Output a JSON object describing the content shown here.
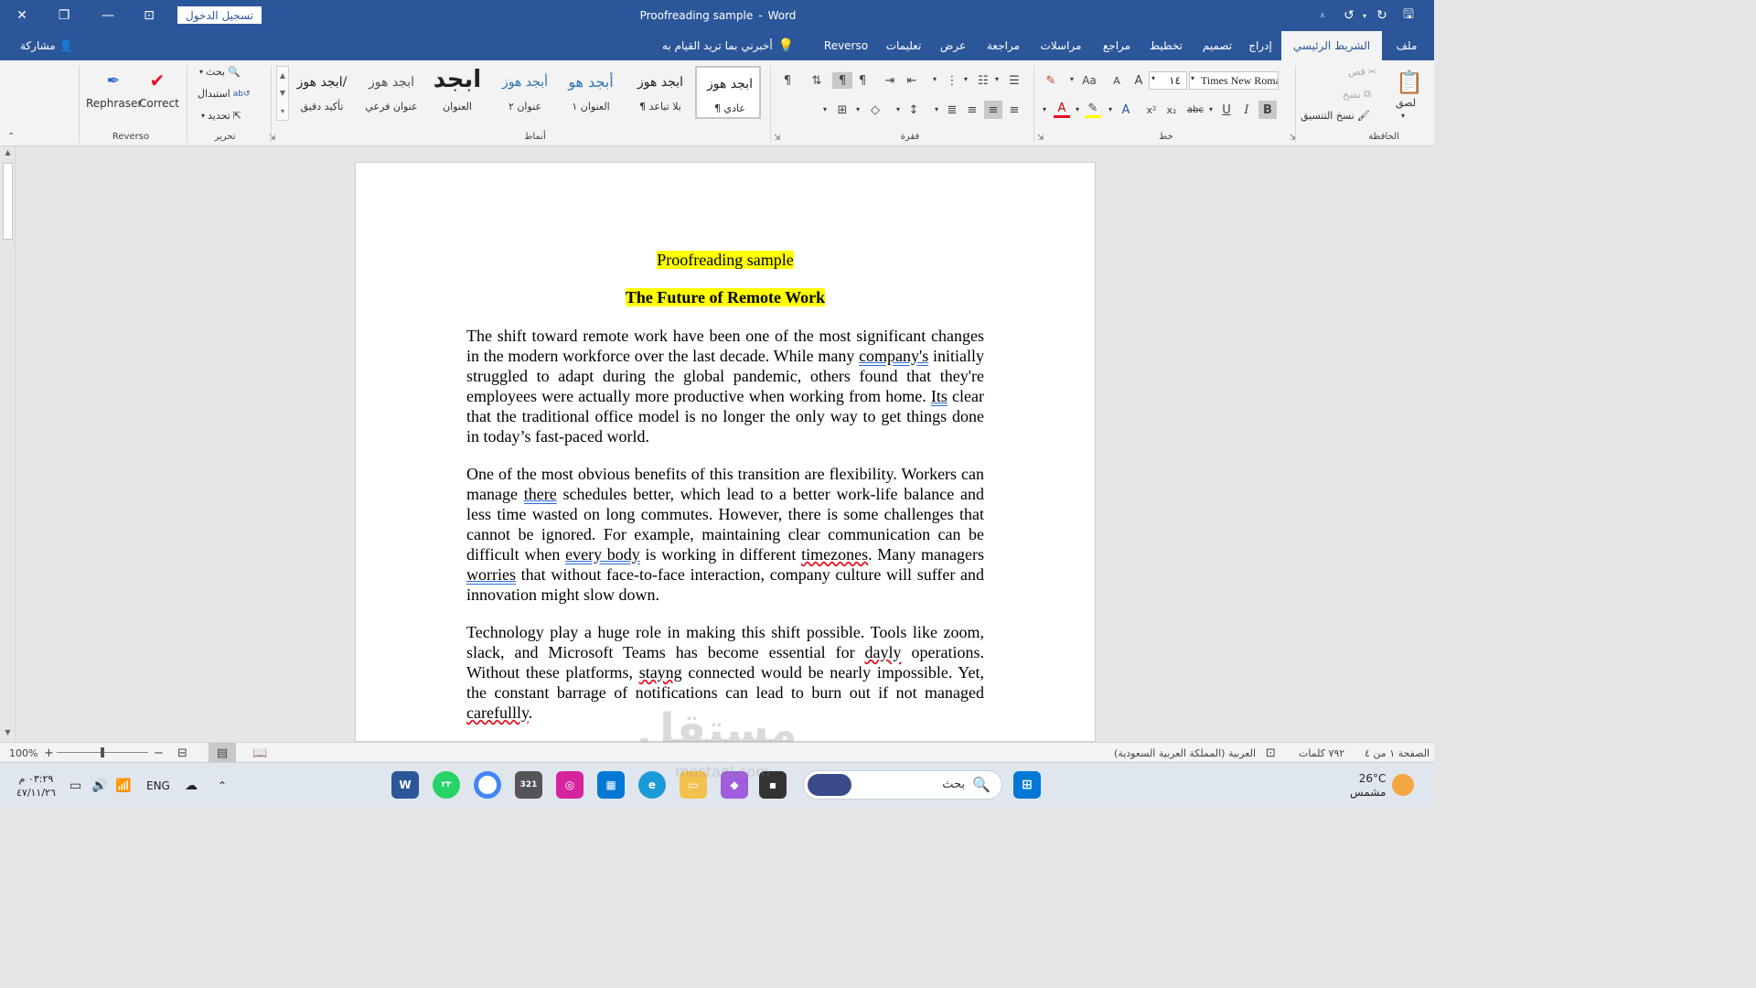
{
  "titlebar": {
    "signin_label": "تسجيل الدخول",
    "doc_name": "Proofreading sample",
    "separator": "-",
    "app_name": "Word"
  },
  "tabs": [
    {
      "label": "ملف"
    },
    {
      "label": "الشريط الرئيسي"
    },
    {
      "label": "إدراج"
    },
    {
      "label": "تصميم"
    },
    {
      "label": "تخطيط"
    },
    {
      "label": "مراجع"
    },
    {
      "label": "مراسلات"
    },
    {
      "label": "مراجعة"
    },
    {
      "label": "عرض"
    },
    {
      "label": "تعليمات"
    },
    {
      "label": "Reverso"
    }
  ],
  "tellme": "أخبرني بما تريد القيام به",
  "share": "مشاركة",
  "ribbon": {
    "clipboard": {
      "label": "الحافظة",
      "paste": "لصق",
      "cut": "قص",
      "copy": "نسخ",
      "format_painter": "نسخ التنسيق"
    },
    "font": {
      "label": "خط",
      "name": "Times New Roman",
      "size": "١٤",
      "change_case": "Aa",
      "bold": "B",
      "italic": "I",
      "underline": "U",
      "strike": "abc",
      "subscript": "x₂",
      "superscript": "x²",
      "grow": "A",
      "shrink": "A"
    },
    "paragraph": {
      "label": "فقرة",
      "pilcrow": "¶"
    },
    "styles": {
      "label": "أنماط",
      "items": [
        {
          "sample": "ابجد هوز",
          "name": "¶ عادي"
        },
        {
          "sample": "ابجد هوز",
          "name": "¶ بلا تباعد"
        },
        {
          "sample": "أبجد هو",
          "name": "العنوان ١"
        },
        {
          "sample": "أبجد هوز",
          "name": "عنوان ٢"
        },
        {
          "sample": "ابجد",
          "name": "العنوان"
        },
        {
          "sample": "ابجد هوز",
          "name": "عنوان فرعي"
        },
        {
          "sample": "ابجد هوز/",
          "name": "تأكيد دقيق"
        }
      ]
    },
    "editing": {
      "label": "تحرير",
      "find": "بحث",
      "replace": "استبدال",
      "select": "تحديد"
    },
    "reverso": {
      "label": "Reverso",
      "rephraser": "Rephraser",
      "correct": "Correct"
    }
  },
  "document": {
    "line1": "Proofreading sample",
    "line2": "The Future of Remote Work",
    "p1": {
      "a": "The shift toward remote work have been one of the most significant changes in the modern workforce over the last decade. While many ",
      "u1": "company's",
      "b": " initially struggled to adapt during the global pandemic, others found that they're employees were actually more productive when working from home. ",
      "u2": "Its",
      "c": " clear that the traditional office model is no longer the only way to get things done in today’s fast-paced world."
    },
    "p2": {
      "a": "One of the most obvious benefits of this transition are flexibility. Workers can manage ",
      "u1": "there",
      "b": " schedules better, which lead to a better work-life balance and less time wasted on long commutes. However, there is some challenges that cannot be ignored. For example, maintaining clear communication can be difficult when ",
      "u2": "every body",
      "c": " is working in different ",
      "s1": "timezones",
      "d": ". Many managers ",
      "u3": "worries",
      "e": " that without face-to-face interaction, company culture will suffer and innovation might slow down."
    },
    "p3": {
      "a": "Technology play a huge role in making this shift possible. Tools like zoom, slack, and Microsoft Teams has become essential for ",
      "s1": "dayly",
      "b": " operations. Without these platforms, ",
      "s2": "stayng",
      "c": " connected would be nearly impossible. Yet, the constant barrage of notifications can lead to burn out if not managed ",
      "s3": "carefullly",
      "d": "."
    }
  },
  "statusbar": {
    "zoom": "100%",
    "page": "الصفحة ١ من ٤",
    "words": "٧٩٢ كلمات",
    "language": "العربية (المملكة العربية السعودية)",
    "zoom_level": 0.5
  },
  "taskbar": {
    "search_placeholder": "بحث",
    "weather_temp": "26°C",
    "weather_desc": "مشمس",
    "lang": "ENG",
    "time": "٠٣:٢٩ م",
    "date": "٤٧/١١/٢٦",
    "whatsapp_badge": "٢٣",
    "calendar_day": "321"
  },
  "watermark": {
    "ar": "مستقل",
    "en": "mostaql.com"
  },
  "colors": {
    "brand": "#2b579a",
    "highlight": "#ffff00",
    "spelling": "#e81123",
    "grammar": "#2b6cd6"
  }
}
